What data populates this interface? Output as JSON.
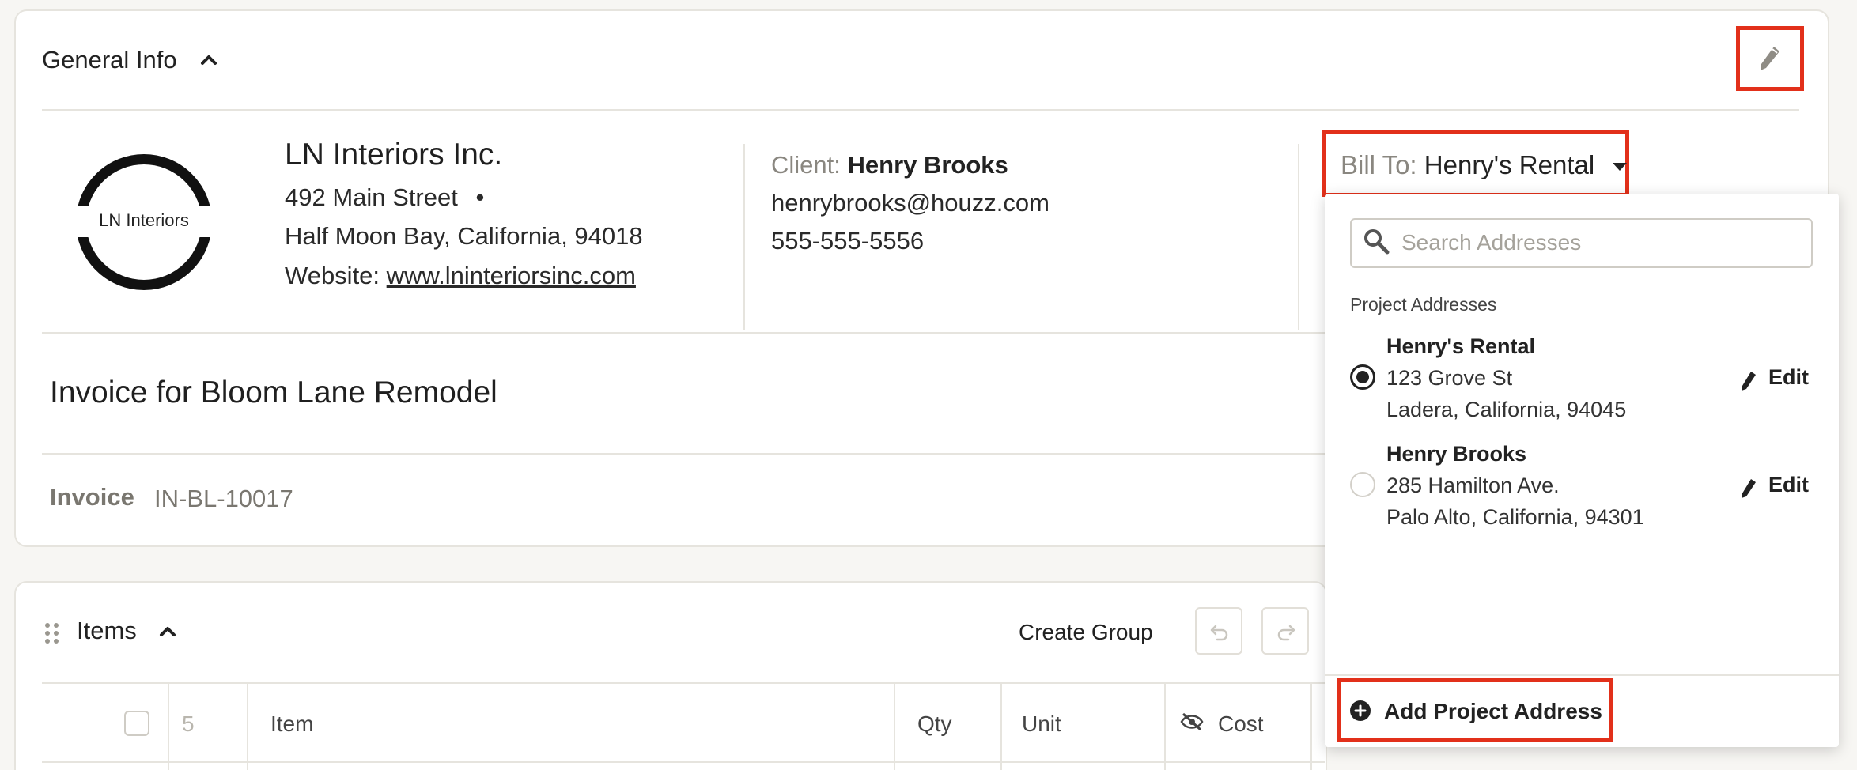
{
  "general_info": {
    "title": "General Info",
    "company": {
      "logo_text": "LN Interiors",
      "name": "LN Interiors Inc.",
      "street": "492 Main Street",
      "bullet": "•",
      "city_line": "Half Moon Bay, California, 94018",
      "website_label": "Website:",
      "website": "www.lninteriorsinc.com"
    },
    "client": {
      "label": "Client:",
      "name": "Henry Brooks",
      "email": "henrybrooks@houzz.com",
      "phone": "555-555-5556"
    },
    "bill_to": {
      "label": "Bill To:",
      "value": "Henry's Rental"
    },
    "invoice_title": "Invoice for Bloom Lane Remodel",
    "invoice_label": "Invoice",
    "invoice_number": "IN-BL-10017"
  },
  "address_dropdown": {
    "search_placeholder": "Search Addresses",
    "heading": "Project Addresses",
    "addresses": [
      {
        "name": "Henry's Rental",
        "line1": "123 Grove St",
        "line2": "Ladera, California, 94045",
        "selected": true,
        "edit_label": "Edit"
      },
      {
        "name": "Henry Brooks",
        "line1": "285 Hamilton Ave.",
        "line2": "Palo Alto, California, 94301",
        "selected": false,
        "edit_label": "Edit"
      }
    ],
    "add_label": "Add Project Address"
  },
  "items": {
    "title": "Items",
    "create_group_label": "Create Group",
    "columns": {
      "count": "5",
      "item": "Item",
      "qty": "Qty",
      "unit": "Unit",
      "cost": "Cost"
    }
  },
  "colors": {
    "highlight": "#e2301a",
    "text": "#222222",
    "muted": "#8a8780",
    "border": "#e6e4de"
  }
}
